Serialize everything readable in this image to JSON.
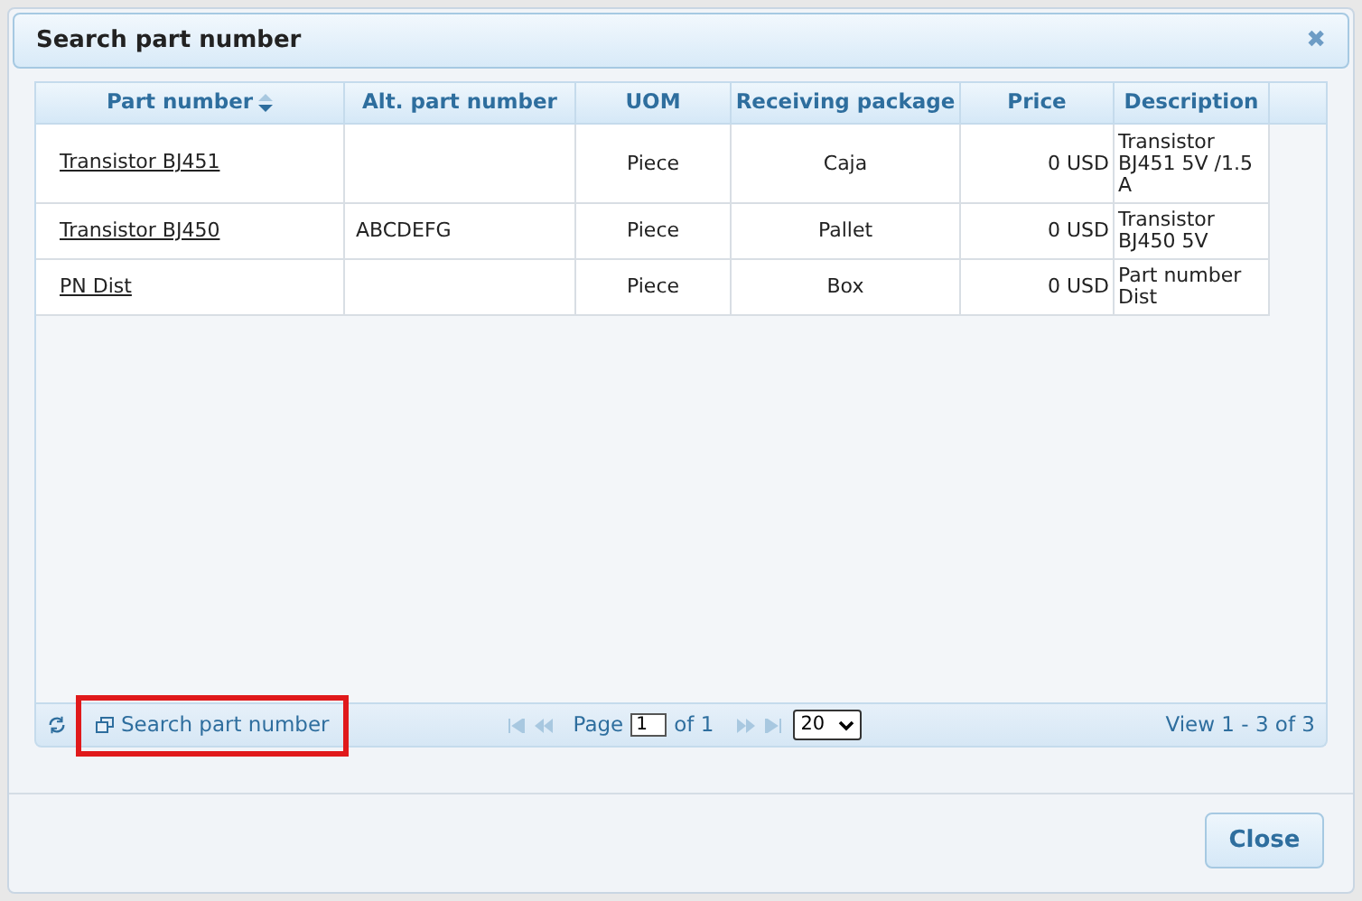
{
  "dialog": {
    "title": "Search part number",
    "close_icon": "✖"
  },
  "table": {
    "columns": [
      {
        "label": "Part number",
        "sorted": true
      },
      {
        "label": "Alt. part number",
        "sorted": false
      },
      {
        "label": "UOM",
        "sorted": false
      },
      {
        "label": "Receiving package",
        "sorted": false
      },
      {
        "label": "Price",
        "sorted": false
      },
      {
        "label": "Description",
        "sorted": false
      }
    ],
    "rows": [
      {
        "part_number": "Transistor BJ451",
        "alt_part_number": "",
        "uom": "Piece",
        "receiving_package": "Caja",
        "price": "0 USD",
        "description": "Transistor BJ451 5V /1.5 A"
      },
      {
        "part_number": "Transistor BJ450",
        "alt_part_number": "ABCDEFG",
        "uom": "Piece",
        "receiving_package": "Pallet",
        "price": "0 USD",
        "description": "Transistor BJ450 5V"
      },
      {
        "part_number": "PN Dist",
        "alt_part_number": "",
        "uom": "Piece",
        "receiving_package": "Box",
        "price": "0 USD",
        "description": "Part number Dist"
      }
    ]
  },
  "pager": {
    "search_button": {
      "label": "Search part number",
      "highlighted": true
    },
    "page_label": "Page",
    "page": "1",
    "of_label": "of 1",
    "page_size": "20",
    "view": "View 1 - 3 of 3"
  },
  "buttons": [
    {
      "label": "Close"
    }
  ]
}
